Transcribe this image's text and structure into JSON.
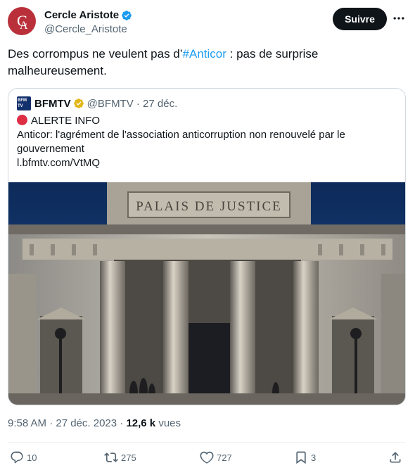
{
  "author": {
    "name": "Cercle Aristote",
    "handle": "@Cercle_Aristote",
    "avatar_letters": "CA"
  },
  "follow_label": "Suivre",
  "tweet": {
    "text_before": "Des corrompus ne veulent pas d’",
    "hashtag": "#Anticor",
    "text_after": " : pas de surprise malheureusement."
  },
  "quote": {
    "logo_text": "BFM TV",
    "name": "BFMTV",
    "handle_date": "@BFMTV · 27 déc.",
    "alert": "ALERTE INFO",
    "headline": "Anticor: l'agrément de l'association anticorruption non renouvelé par le gouvernement",
    "link": "l.bfmtv.com/VtMQ",
    "image_caption": "PALAIS DE JUSTICE"
  },
  "meta": {
    "time_date": "9:58 AM · 27 déc. 2023 · ",
    "views_count": "12,6 k",
    "views_label": " vues"
  },
  "actions": {
    "replies": "10",
    "retweets": "275",
    "likes": "727",
    "bookmarks": "3"
  },
  "colors": {
    "accent": "#1d9bf0",
    "follow_bg": "#0f1419",
    "avatar_bg": "#b9303a",
    "alert_red": "#dd2e44"
  },
  "icons": [
    "verified-badge-icon",
    "more-icon",
    "gold-badge-icon",
    "reply-icon",
    "retweet-icon",
    "like-icon",
    "bookmark-icon",
    "share-icon"
  ]
}
